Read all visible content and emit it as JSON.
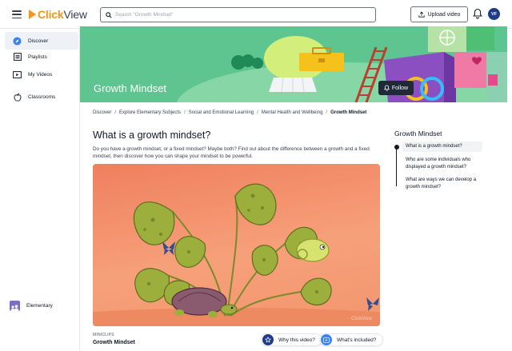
{
  "header": {
    "brand_part1": "Click",
    "brand_part2": "View",
    "search_placeholder": "Search \"Growth Mindset\"",
    "upload_label": "Upload video",
    "avatar_initials": "VF"
  },
  "sidebar": {
    "items": [
      {
        "label": "Discover",
        "icon": "compass-icon"
      },
      {
        "label": "Playlists",
        "icon": "list-icon"
      },
      {
        "label": "My Videos",
        "icon": "play-box-icon"
      },
      {
        "label": "Classrooms",
        "icon": "apple-icon"
      }
    ],
    "bottom_label": "Elementary"
  },
  "banner": {
    "title": "Growth Mindset",
    "follow_label": "Follow",
    "colors": {
      "background": "#5ec590",
      "sky": "#7fd4a4"
    }
  },
  "breadcrumb": [
    "Discover",
    "Explore Elementary Subjects",
    "Social and Emotional Learning",
    "Mental Health and Wellbeing",
    "Growth Mindset"
  ],
  "breadcrumb_separator": "/",
  "main": {
    "title": "What is a growth mindset?",
    "description": "Do you have a growth mindset, or a fixed mindset? Maybe both? Find out about the difference between a growth and a fixed mindset, then discover how you can shape your mindset to be powerful.",
    "video_watermark": "ClickView",
    "tag": "MINICLIPS",
    "video_title": "Growth Mindset",
    "why_label": "Why this video?",
    "included_label": "What's included?"
  },
  "toc": {
    "title": "Growth Mindset",
    "items": [
      "What is a growth mindset?",
      "Who are some individuals who displayed a growth mindset?",
      "What are ways we can develop a growth mindset?"
    ]
  },
  "accent_color": "#f7941d"
}
